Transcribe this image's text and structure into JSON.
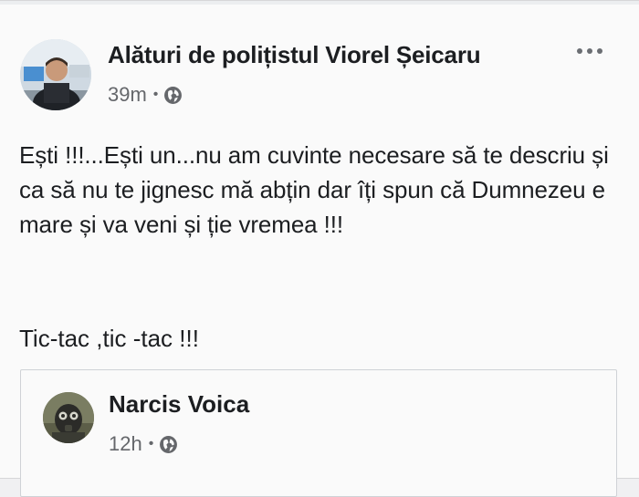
{
  "post": {
    "author": "Alături de polițistul Viorel Șeicaru",
    "time": "39m",
    "separator": "•",
    "privacy_icon": "globe-icon",
    "menu_icon": "more-options-icon",
    "text_main": "Ești !!!...Ești un...nu am cuvinte necesare să te descriu și ca să nu te jignesc mă abțin dar îți spun că Dumnezeu e mare și va veni și ție vremea !!!",
    "text_second": "Tic-tac ,tic -tac !!!"
  },
  "shared_post": {
    "author": "Narcis Voica",
    "time": "12h",
    "separator": "•",
    "privacy_icon": "globe-icon"
  },
  "colors": {
    "text": "#1c1e21",
    "muted": "#65676b",
    "background": "#fafafa",
    "border": "#cfd2d6"
  }
}
